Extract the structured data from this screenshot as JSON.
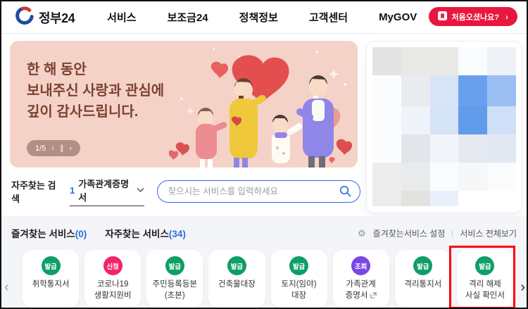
{
  "header": {
    "logo_text": "정부24",
    "nav": [
      {
        "id": "services",
        "label": "서비스"
      },
      {
        "id": "subsidy24",
        "label": "보조금24"
      },
      {
        "id": "policy-info",
        "label": "정책정보"
      },
      {
        "id": "customer-center",
        "label": "고객센터"
      },
      {
        "id": "mygov",
        "label": "MyGOV"
      }
    ],
    "cta": {
      "label": "처음오셨나요?",
      "arrow": "›"
    }
  },
  "banner": {
    "title_lines": {
      "0": "한 해 동안",
      "1": "보내주신 사랑과 관심에",
      "2": "깊이 감사드립니다."
    },
    "page_indicator": "1/5",
    "controls": {
      "prev": "‹",
      "pause": "∥",
      "next": "›"
    }
  },
  "search": {
    "label": "자주찾는 검색",
    "hot_keyword_rank": "1",
    "hot_keyword": "가족관계증명서",
    "placeholder": "찾으시는 서비스를 입력하세요"
  },
  "services": {
    "tabs": [
      {
        "label": "즐겨찾는 서비스",
        "count": "(0)"
      },
      {
        "label": "자주찾는 서비스",
        "count": "(34)"
      }
    ],
    "settings_link": "즐겨찾는서비스 설정",
    "view_all_link": "서비스 전체보기",
    "badge_colors": {
      "issue": "#0e9e66",
      "apply": "#f1246c",
      "inquiry": "#7b45e4"
    },
    "cards": [
      {
        "id": "school-entrance-notice",
        "badge": "발급",
        "badge_type": "issue",
        "label_lines": [
          "취학통지서"
        ]
      },
      {
        "id": "covid19-living-support",
        "badge": "신청",
        "badge_type": "apply",
        "label_lines": [
          "코로나19",
          "생활지원비"
        ]
      },
      {
        "id": "resident-registration-copy",
        "badge": "발급",
        "badge_type": "issue",
        "label_lines": [
          "주민등록등본",
          "(초본)"
        ]
      },
      {
        "id": "building-register",
        "badge": "발급",
        "badge_type": "issue",
        "label_lines": [
          "건축물대장"
        ]
      },
      {
        "id": "land-register",
        "badge": "발급",
        "badge_type": "issue",
        "label_lines": [
          "토지(임야)",
          "대장"
        ]
      },
      {
        "id": "family-relation-certificate",
        "badge": "조회",
        "badge_type": "inquiry",
        "label_lines": [
          "가족관계",
          "증명서"
        ],
        "external": true
      },
      {
        "id": "quarantine-notice",
        "badge": "발급",
        "badge_type": "issue",
        "label_lines": [
          "격리통지서"
        ]
      },
      {
        "id": "quarantine-release-confirmation",
        "badge": "발급",
        "badge_type": "issue",
        "label_lines": [
          "격리 해제",
          "사실 확인서"
        ],
        "highlighted": true
      }
    ],
    "prev_arrow": "‹",
    "next_arrow": "›"
  },
  "preview_panel": {
    "rows": [
      {
        "h": 40,
        "cells": [
          "#e3e3e3",
          "#e9e9e6",
          "#e9e9e6",
          "#fafbfd",
          "#eef1f6"
        ]
      },
      {
        "h": 44,
        "cells": [
          "#fbfcfe",
          "#e9ebee",
          "#d8e5f8",
          "#69a0ee",
          "#9cbff3"
        ]
      },
      {
        "h": 40,
        "cells": [
          "#fbfcfe",
          "#eff4fb",
          "#d5e3f6",
          "#639bec",
          "#cfdff7"
        ]
      },
      {
        "h": 40,
        "cells": [
          "#fafcfe",
          "#e2e5e9",
          "#f1f5fa",
          "#e6e9ef",
          "#e2e8f2"
        ]
      },
      {
        "h": 40,
        "cells": [
          "#ededee",
          "#e8eaec",
          "#fafbfc",
          "#f5f7f9",
          "#fafbfc"
        ]
      },
      {
        "h": 22,
        "cells": [
          "#ececea",
          "#e2e3df",
          "#e7f0fa",
          "#ffffff",
          "#ffffff"
        ]
      }
    ]
  },
  "colors": {
    "brand_blue": "#2f6be4",
    "cta_red": "#e8173f",
    "banner_bg": "#f5d2c8",
    "banner_text": "#7c4131",
    "section_bg": "#f3f5f9",
    "annotation_red": "#ff0000",
    "badge_issue_green": "#0e9e66",
    "badge_apply_pink": "#f1246c",
    "badge_inquiry_purple": "#7b45e4"
  }
}
